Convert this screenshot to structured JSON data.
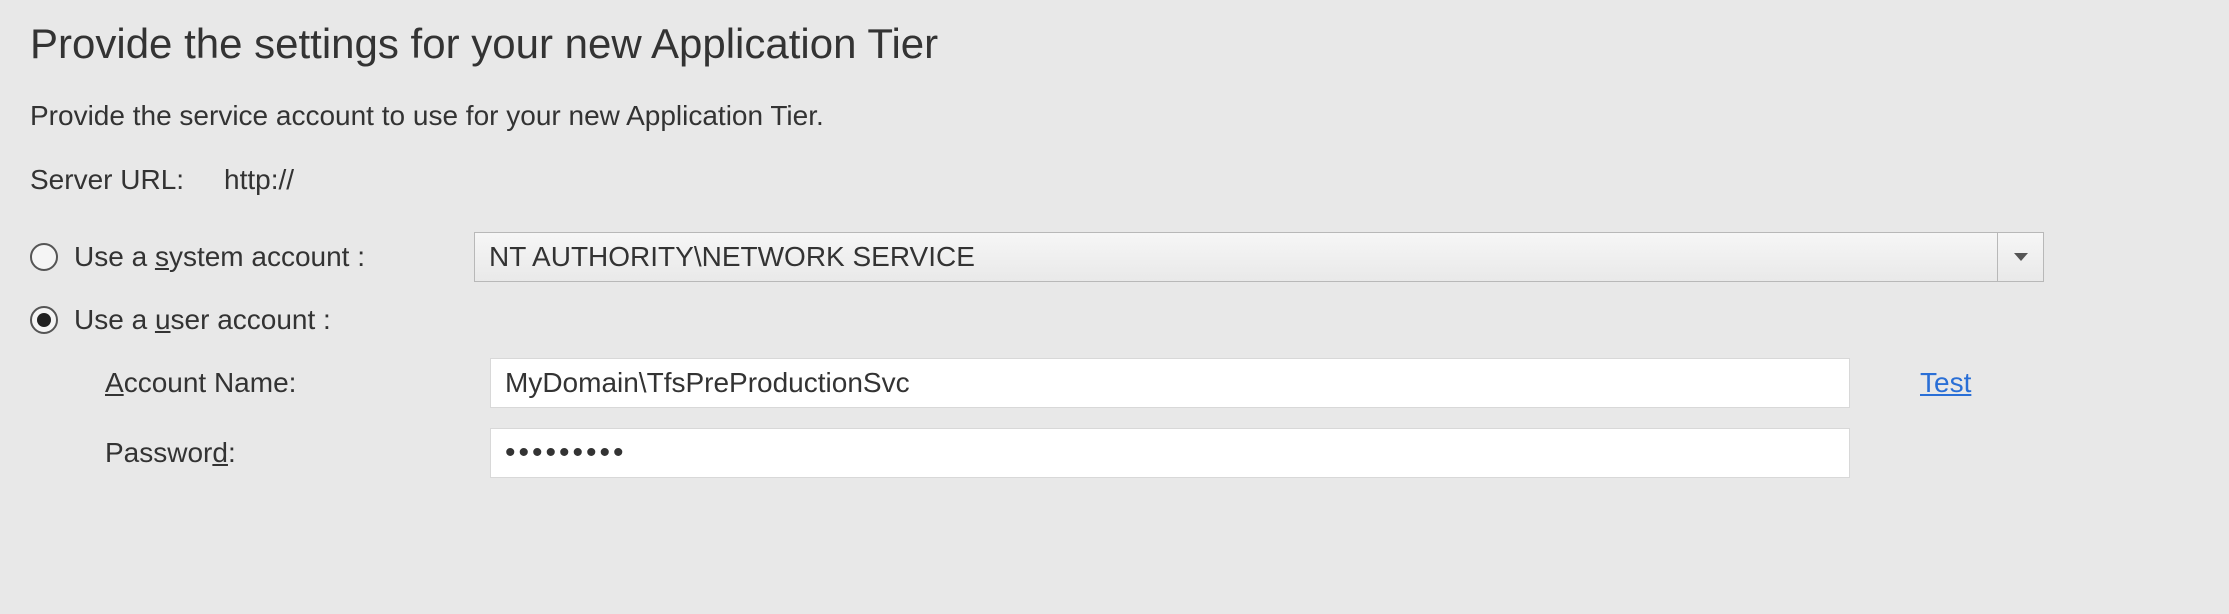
{
  "title": "Provide the settings for your new Application Tier",
  "subtitle": "Provide the service account to use for your new Application Tier.",
  "server_url": {
    "label": "Server URL:",
    "value": "http://"
  },
  "radio": {
    "system": {
      "prefix": "Use a ",
      "key": "s",
      "suffix": "ystem account :",
      "selected": false
    },
    "user": {
      "prefix": "Use a ",
      "key": "u",
      "suffix": "ser account :",
      "selected": true
    }
  },
  "system_account_select": {
    "value": "NT AUTHORITY\\NETWORK SERVICE"
  },
  "account_name": {
    "label_prefix": "",
    "label_key": "A",
    "label_suffix": "ccount Name:",
    "value": "MyDomain\\TfsPreProductionSvc"
  },
  "password": {
    "label_prefix": "Passwor",
    "label_key": "d",
    "label_suffix": ":",
    "value": "•••••••••"
  },
  "test_link": "Test"
}
